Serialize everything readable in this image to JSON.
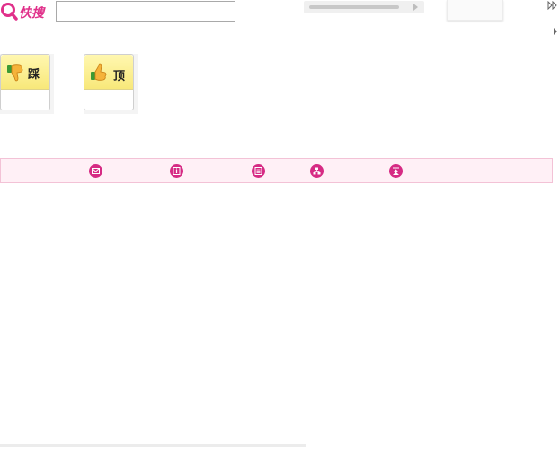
{
  "quick_search": {
    "label": "快搜",
    "input_value": ""
  },
  "vote": {
    "dislike_label": "踩",
    "like_label": "顶"
  },
  "toolbar": {
    "icons": [
      "mail-icon",
      "info-icon",
      "list-icon",
      "sitemap-icon",
      "top-icon"
    ]
  },
  "colors": {
    "accent": "#e0308a",
    "toolbar_bg": "#fff0f6",
    "toolbar_border": "#f3c2d6",
    "toolbar_icon": "#d62b84"
  }
}
